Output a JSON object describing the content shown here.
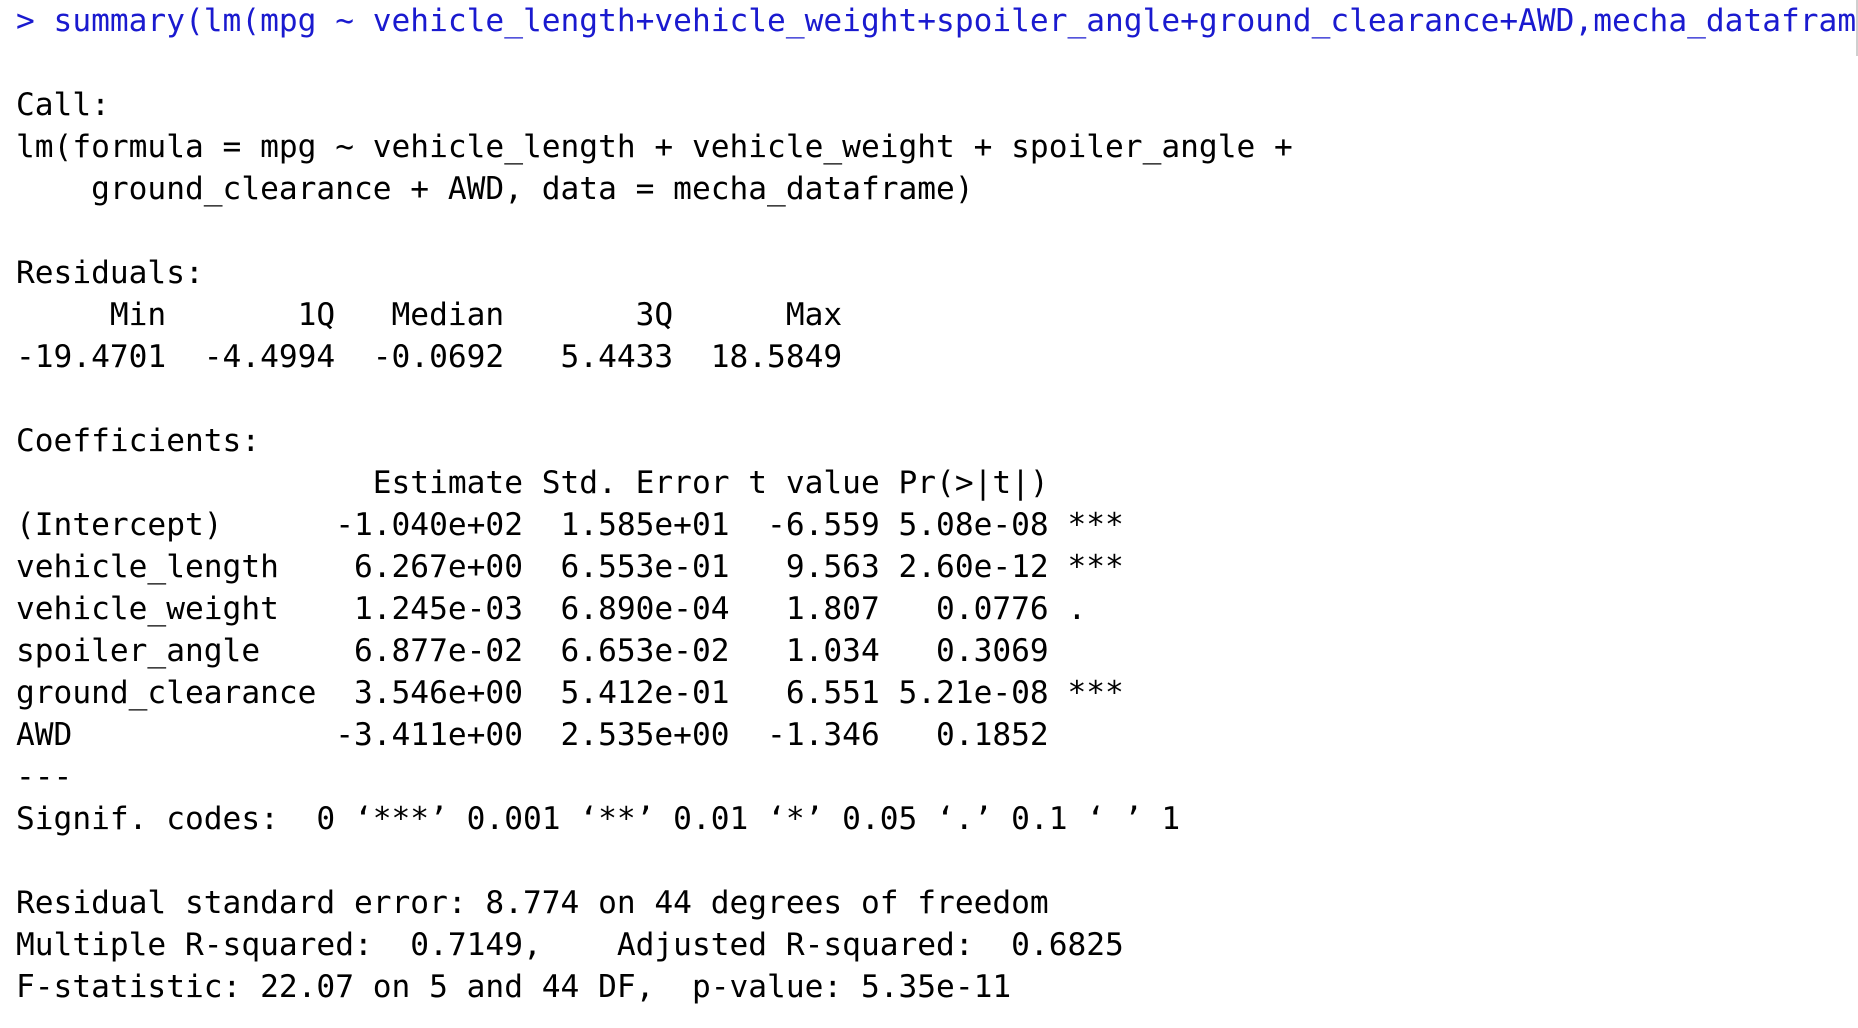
{
  "console": {
    "command_line": "> summary(lm(mpg ~ vehicle_length+vehicle_weight+spoiler_angle+ground_clearance+AWD,mecha_dataframe))",
    "call_header": "Call:",
    "call_line1": "lm(formula = mpg ~ vehicle_length + vehicle_weight + spoiler_angle + ",
    "call_line2": "    ground_clearance + AWD, data = mecha_dataframe)",
    "residuals_header": "Residuals:",
    "residuals_labels": "     Min       1Q   Median       3Q      Max ",
    "residuals_values": "-19.4701  -4.4994  -0.0692   5.4433  18.5849 ",
    "coefficients_header": "Coefficients:",
    "coef_columns": "                   Estimate Std. Error t value Pr(>|t|)    ",
    "coef_rows": [
      "(Intercept)      -1.040e+02  1.585e+01  -6.559 5.08e-08 ***",
      "vehicle_length    6.267e+00  6.553e-01   9.563 2.60e-12 ***",
      "vehicle_weight    1.245e-03  6.890e-04   1.807   0.0776 .  ",
      "spoiler_angle     6.877e-02  6.653e-02   1.034   0.3069    ",
      "ground_clearance  3.546e+00  5.412e-01   6.551 5.21e-08 ***",
      "AWD              -3.411e+00  2.535e+00  -1.346   0.1852    "
    ],
    "separator": "---",
    "signif_codes": "Signif. codes:  0 ‘***’ 0.001 ‘**’ 0.01 ‘*’ 0.05 ‘.’ 0.1 ‘ ’ 1",
    "rse_line": "Residual standard error: 8.774 on 44 degrees of freedom",
    "r2_line": "Multiple R-squared:  0.7149,\tAdjusted R-squared:  0.6825 ",
    "fstat_line": "F-statistic: 22.07 on 5 and 44 DF,  p-value: 5.35e-11"
  },
  "colors": {
    "command": "#1a1acf",
    "output": "#000000",
    "background": "#ffffff"
  }
}
